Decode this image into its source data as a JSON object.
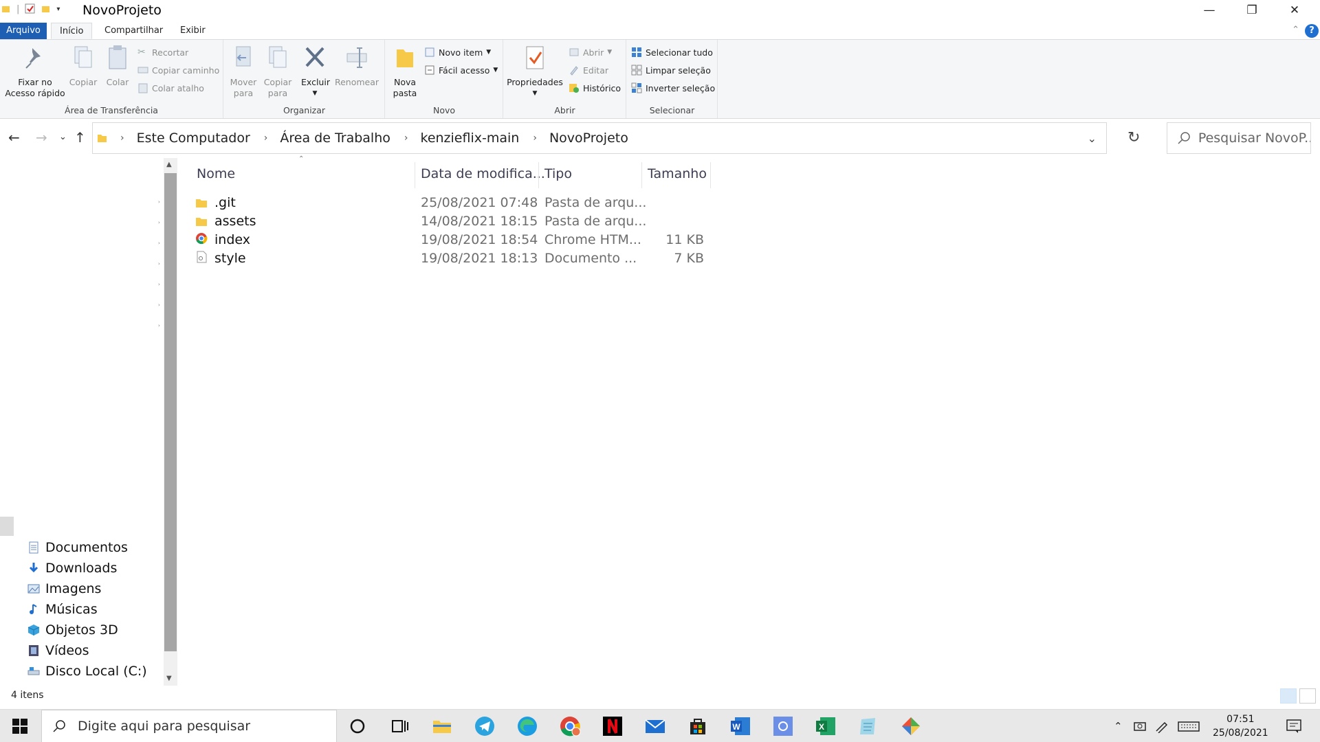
{
  "window": {
    "title": "NovoProjeto"
  },
  "ribbon": {
    "tabs": [
      {
        "label": "Arquivo"
      },
      {
        "label": "Início"
      },
      {
        "label": "Compartilhar"
      },
      {
        "label": "Exibir"
      }
    ],
    "clipboard": {
      "pin_label_1": "Fixar no",
      "pin_label_2": "Acesso rápido",
      "copy": "Copiar",
      "paste": "Colar",
      "cut": "Recortar",
      "copy_path": "Copiar caminho",
      "paste_shortcut": "Colar atalho",
      "group": "Área de Transferência"
    },
    "organize": {
      "move_1": "Mover",
      "move_2": "para",
      "copyto_1": "Copiar",
      "copyto_2": "para",
      "delete": "Excluir",
      "rename": "Renomear",
      "group": "Organizar"
    },
    "new": {
      "new_folder_1": "Nova",
      "new_folder_2": "pasta",
      "new_item": "Novo item",
      "easy_access": "Fácil acesso",
      "group": "Novo"
    },
    "open": {
      "properties": "Propriedades",
      "open": "Abrir",
      "edit": "Editar",
      "history": "Histórico",
      "group": "Abrir"
    },
    "select": {
      "select_all": "Selecionar tudo",
      "select_none": "Limpar seleção",
      "invert": "Inverter seleção",
      "group": "Selecionar"
    }
  },
  "address": {
    "crumbs": [
      "Este Computador",
      "Área de Trabalho",
      "kenzieflix-main",
      "NovoProjeto"
    ],
    "search_placeholder": "Pesquisar NovoP..."
  },
  "nav": {
    "items": [
      {
        "label": "Documentos",
        "icon": "documents-icon"
      },
      {
        "label": "Downloads",
        "icon": "downloads-icon"
      },
      {
        "label": "Imagens",
        "icon": "pictures-icon"
      },
      {
        "label": "Músicas",
        "icon": "music-icon"
      },
      {
        "label": "Objetos 3D",
        "icon": "objects3d-icon"
      },
      {
        "label": "Vídeos",
        "icon": "videos-icon"
      },
      {
        "label": "Disco Local (C:)",
        "icon": "drive-icon"
      }
    ]
  },
  "files": {
    "columns": {
      "name": "Nome",
      "date": "Data de modifica...",
      "type": "Tipo",
      "size": "Tamanho"
    },
    "rows": [
      {
        "name": ".git",
        "date": "25/08/2021 07:48",
        "type": "Pasta de arqu...",
        "size": "",
        "icon": "folder-icon"
      },
      {
        "name": "assets",
        "date": "14/08/2021 18:15",
        "type": "Pasta de arqu...",
        "size": "",
        "icon": "folder-icon"
      },
      {
        "name": "index",
        "date": "19/08/2021 18:54",
        "type": "Chrome HTM...",
        "size": "11 KB",
        "icon": "chrome-icon"
      },
      {
        "name": "style",
        "date": "19/08/2021 18:13",
        "type": "Documento ...",
        "size": "7 KB",
        "icon": "css-file-icon"
      }
    ]
  },
  "status": {
    "count": "4 itens"
  },
  "taskbar": {
    "search_placeholder": "Digite aqui para pesquisar",
    "time": "07:51",
    "date": "25/08/2021"
  },
  "colors": {
    "accent": "#1f5fb3",
    "folder": "#f7c948",
    "taskbar": "#e8e8e8"
  }
}
